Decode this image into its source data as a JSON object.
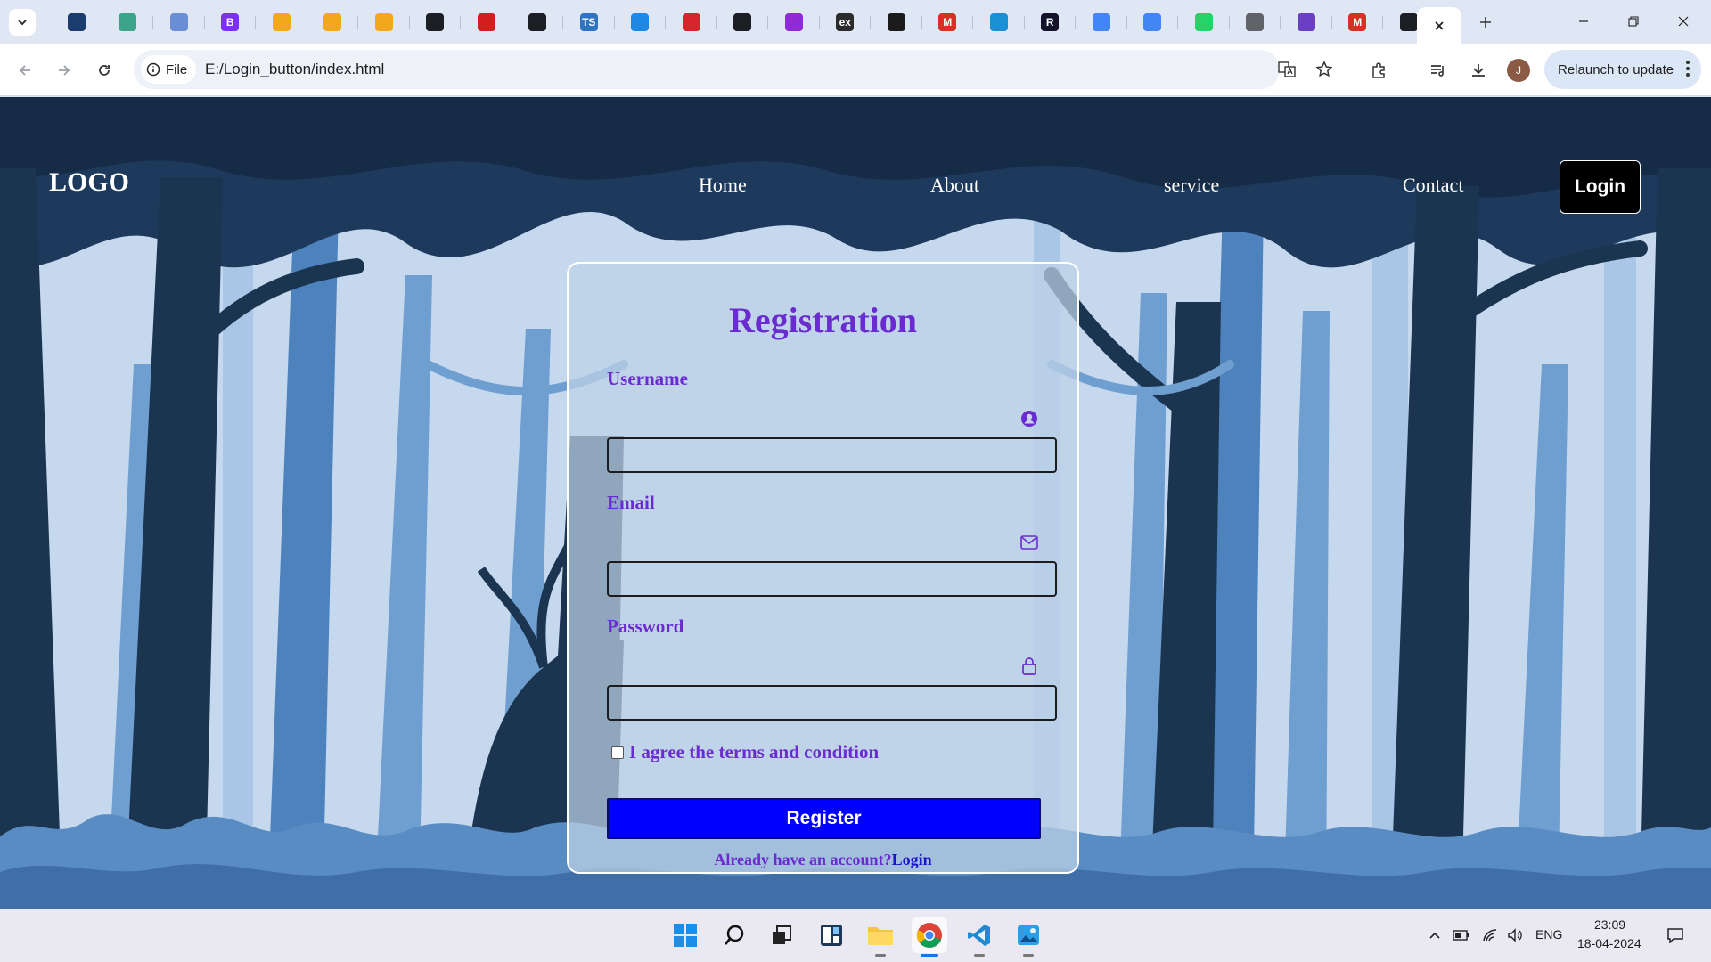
{
  "browser": {
    "tab_favicons": [
      {
        "name": "dark-blue-doc-favicon",
        "color": "#1a3d6e",
        "glyph": ""
      },
      {
        "name": "chatgpt-favicon",
        "color": "#3aa38a",
        "glyph": ""
      },
      {
        "name": "chart-favicon",
        "color": "#6b8fd6",
        "glyph": ""
      },
      {
        "name": "bootstrap-favicon",
        "color": "#7b2ff7",
        "glyph": "B"
      },
      {
        "name": "leetcode-favicon",
        "color": "#f3a71d",
        "glyph": ""
      },
      {
        "name": "leetcode-favicon",
        "color": "#f3a71d",
        "glyph": ""
      },
      {
        "name": "leetcode-favicon",
        "color": "#f3a71d",
        "glyph": ""
      },
      {
        "name": "github-favicon",
        "color": "#1b1f23",
        "glyph": ""
      },
      {
        "name": "red-n-favicon",
        "color": "#d41e1e",
        "glyph": ""
      },
      {
        "name": "github-favicon",
        "color": "#1b1f23",
        "glyph": ""
      },
      {
        "name": "typescript-favicon",
        "color": "#2f74c0",
        "glyph": "TS"
      },
      {
        "name": "mui-favicon",
        "color": "#1e88e5",
        "glyph": ""
      },
      {
        "name": "red-banner-favicon",
        "color": "#d8242b",
        "glyph": ""
      },
      {
        "name": "github-favicon",
        "color": "#1b1f23",
        "glyph": ""
      },
      {
        "name": "purple-circle-favicon",
        "color": "#8e2bd6",
        "glyph": ""
      },
      {
        "name": "ex-favicon",
        "color": "#2b2b2b",
        "glyph": "ex"
      },
      {
        "name": "terminal-favicon",
        "color": "#1b1b1b",
        "glyph": ""
      },
      {
        "name": "gmail-favicon",
        "color": "#d93025",
        "glyph": "M"
      },
      {
        "name": "blue-page-favicon",
        "color": "#1a8fd6",
        "glyph": ""
      },
      {
        "name": "r-favicon",
        "color": "#12122a",
        "glyph": "R"
      },
      {
        "name": "google-docs-favicon",
        "color": "#4285f4",
        "glyph": ""
      },
      {
        "name": "google-docs-favicon",
        "color": "#4285f4",
        "glyph": ""
      },
      {
        "name": "whatsapp-favicon",
        "color": "#25d366",
        "glyph": ""
      },
      {
        "name": "globe-favicon",
        "color": "#5f6368",
        "glyph": ""
      },
      {
        "name": "purple-list-favicon",
        "color": "#6b3fc4",
        "glyph": ""
      },
      {
        "name": "gmail-favicon",
        "color": "#d93025",
        "glyph": "M"
      },
      {
        "name": "github-favicon",
        "color": "#1b1f23",
        "glyph": ""
      }
    ],
    "site_chip_label": "File",
    "url": "E:/Login_button/index.html",
    "relaunch_label": "Relaunch to update",
    "profile_initial": "J"
  },
  "page": {
    "logo": "LOGO",
    "nav": {
      "home": "Home",
      "about": "About",
      "service": "service",
      "contact": "Contact",
      "login": "Login"
    },
    "form": {
      "title": "Registration",
      "username_label": "Username",
      "email_label": "Email",
      "password_label": "Password",
      "username_value": "",
      "email_value": "",
      "password_value": "",
      "terms_label": "I agree the terms and condition",
      "terms_checked": false,
      "register_label": "Register",
      "account_question": "Already have an account?",
      "account_link": "Login"
    },
    "colors": {
      "accent_purple": "#6a2bd0",
      "register_blue": "#0000ff",
      "link_blue": "#1c14c9"
    }
  },
  "taskbar": {
    "apps": [
      "start-icon",
      "search-icon",
      "task-view-icon",
      "widgets-icon",
      "file-explorer-icon",
      "chrome-icon",
      "vscode-icon",
      "photos-icon"
    ],
    "language": "ENG",
    "time": "23:09",
    "date": "18-04-2024"
  }
}
